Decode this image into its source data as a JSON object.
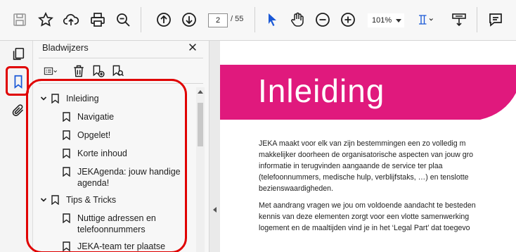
{
  "toolbar": {
    "page_current": "2",
    "page_total": "/ 55",
    "zoom": "101%"
  },
  "bookmarks_panel": {
    "title": "Bladwijzers",
    "items": [
      {
        "label": "Inleiding",
        "level": 0,
        "expanded": true
      },
      {
        "label": "Navigatie",
        "level": 1
      },
      {
        "label": "Opgelet!",
        "level": 1
      },
      {
        "label": "Korte inhoud",
        "level": 1
      },
      {
        "label": "JEKAgenda: jouw handige agenda!",
        "level": 1
      },
      {
        "label": "Tips & Tricks",
        "level": 0,
        "expanded": true
      },
      {
        "label": "Nuttige adressen en telefoonnummers",
        "level": 1
      },
      {
        "label": "JEKA-team ter plaatse",
        "level": 1
      }
    ]
  },
  "document": {
    "heading": "Inleiding",
    "lines": [
      "JEKA maakt voor elk van zijn bestemmingen een zo volledig m",
      "makkelijker doorheen de organisatorische aspecten van jouw gro",
      "informatie  in  terugvinden  aangaande  de  service  ter  plaa",
      "(telefoonnummers, medische hulp, verblijfstaks, …) en tenslotte",
      "bezienswaardigheden.",
      "Met aandrang vragen we jou om voldoende aandacht te besteden",
      "kennis van deze elementen zorgt voor een vlotte samenwerking",
      "logement en de maaltijden vind je in het ‘Legal Part’ dat toegevo"
    ]
  },
  "colors": {
    "banner": "#e0197d",
    "highlight": "#e00000",
    "accent": "#1a58d6"
  }
}
